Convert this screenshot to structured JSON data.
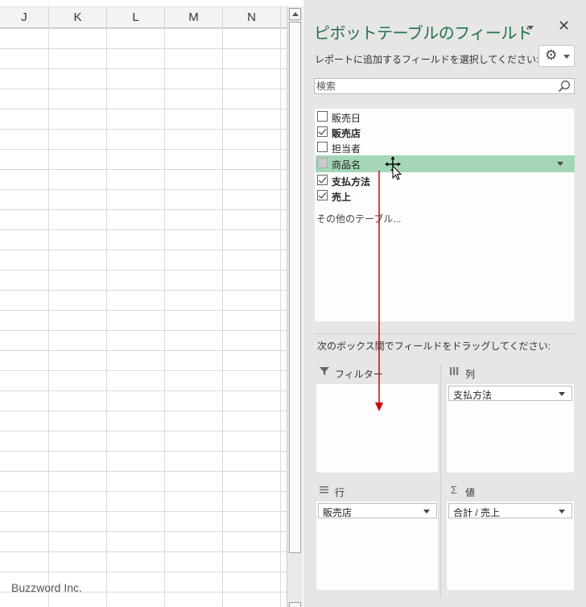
{
  "spreadsheet": {
    "columns": [
      "J",
      "K",
      "L",
      "M",
      "N"
    ],
    "watermark": "Buzzword Inc."
  },
  "pivot_pane": {
    "title": "ピボットテーブルのフィールド",
    "close_label": "✕",
    "subtitle": "レポートに追加するフィールドを選択してください:",
    "gear_icon": "gear-icon",
    "search": {
      "placeholder": "検索",
      "value": ""
    },
    "fields": [
      {
        "label": "販売日",
        "checked": false,
        "bold": false,
        "highlighted": false
      },
      {
        "label": "販売店",
        "checked": true,
        "bold": true,
        "highlighted": false
      },
      {
        "label": "担当者",
        "checked": false,
        "bold": false,
        "highlighted": false
      },
      {
        "label": "商品名",
        "checked": false,
        "bold": false,
        "highlighted": true
      },
      {
        "label": "支払方法",
        "checked": true,
        "bold": true,
        "highlighted": false
      },
      {
        "label": "売上",
        "checked": true,
        "bold": true,
        "highlighted": false
      }
    ],
    "more_tables": "その他のテーブル...",
    "drag_instruction": "次のボックス間でフィールドをドラッグしてください:",
    "areas": {
      "filters": {
        "label": "フィルター",
        "items": []
      },
      "columns": {
        "label": "列",
        "items": [
          "支払方法"
        ]
      },
      "rows": {
        "label": "行",
        "items": [
          "販売店"
        ]
      },
      "values": {
        "label": "値",
        "items": [
          "合計 / 売上"
        ]
      }
    },
    "accent_color": "#217346",
    "highlight_color": "#a3d7b6",
    "drag_arrow_color": "#d40000"
  }
}
